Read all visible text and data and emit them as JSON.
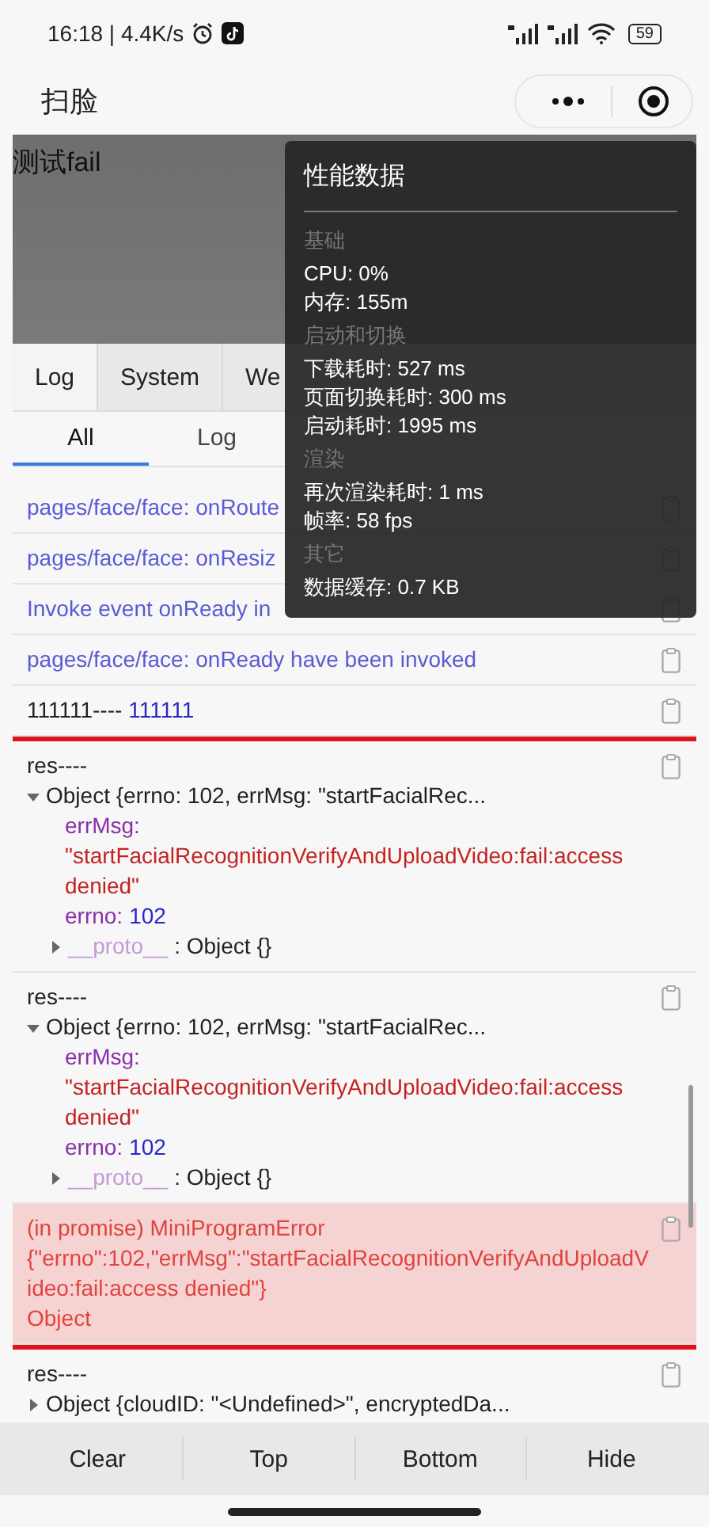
{
  "status_bar": {
    "time": "16:18 | 4.4K/s",
    "battery": "59"
  },
  "header": {
    "title": "扫脸"
  },
  "camera": {
    "text": "测试fail"
  },
  "perf_panel": {
    "title": "性能数据",
    "sections": [
      {
        "heading": "基础",
        "lines": [
          "CPU: 0%",
          "内存: 155m"
        ]
      },
      {
        "heading": "启动和切换",
        "lines": [
          "下载耗时: 527 ms",
          "页面切换耗时: 300 ms",
          "启动耗时: 1995 ms"
        ]
      },
      {
        "heading": "渲染",
        "lines": [
          "再次渲染耗时: 1 ms",
          "帧率: 58 fps"
        ]
      },
      {
        "heading": "其它",
        "lines": [
          "数据缓存: 0.7 KB"
        ]
      }
    ]
  },
  "tabs": [
    {
      "label": "Log",
      "selected": true
    },
    {
      "label": "System",
      "selected": false
    },
    {
      "label": "We",
      "selected": false
    }
  ],
  "filters": [
    {
      "label": "All",
      "selected": true
    },
    {
      "label": "Log",
      "selected": false
    }
  ],
  "log_groups": [
    {
      "highlighted": false,
      "entries": [
        {
          "kind": "info",
          "text": "pages/face/face: onRoute"
        },
        {
          "kind": "info",
          "text": "pages/face/face: onResiz"
        },
        {
          "kind": "info",
          "text": "Invoke event onReady in"
        },
        {
          "kind": "info",
          "text": "pages/face/face: onReady have been invoked"
        },
        {
          "kind": "pair",
          "label": "111111----",
          "value": "111111"
        }
      ]
    },
    {
      "highlighted": true,
      "entries": [
        {
          "kind": "object",
          "label": "res----",
          "summary": "Object {errno: 102, errMsg: \"startFacialRec...",
          "expanded": true,
          "props": [
            {
              "key": "errMsg:",
              "value": "\"startFacialRecognitionVerifyAndUploadVideo:fail:access denied\"",
              "kind": "string"
            },
            {
              "key": "errno:",
              "value": "102",
              "kind": "number"
            }
          ],
          "proto_key": "__proto__",
          "proto_value": ": Object {}"
        },
        {
          "kind": "object",
          "label": "res----",
          "summary": "Object {errno: 102, errMsg: \"startFacialRec...",
          "expanded": true,
          "props": [
            {
              "key": "errMsg:",
              "value": "\"startFacialRecognitionVerifyAndUploadVideo:fail:access denied\"",
              "kind": "string"
            },
            {
              "key": "errno:",
              "value": "102",
              "kind": "number"
            }
          ],
          "proto_key": "__proto__",
          "proto_value": ": Object {}"
        },
        {
          "kind": "error",
          "lines": [
            "(in promise) MiniProgramError",
            "{\"errno\":102,\"errMsg\":\"startFacialRecognitionVerifyAndUploadVideo:fail:access denied\"}",
            "Object"
          ]
        }
      ]
    },
    {
      "highlighted": false,
      "entries": [
        {
          "kind": "object",
          "label": "res----",
          "summary": "Object {cloudID: \"<Undefined>\", encryptedDa...",
          "expanded": false
        }
      ]
    }
  ],
  "buttons": [
    "Clear",
    "Top",
    "Bottom",
    "Hide"
  ]
}
